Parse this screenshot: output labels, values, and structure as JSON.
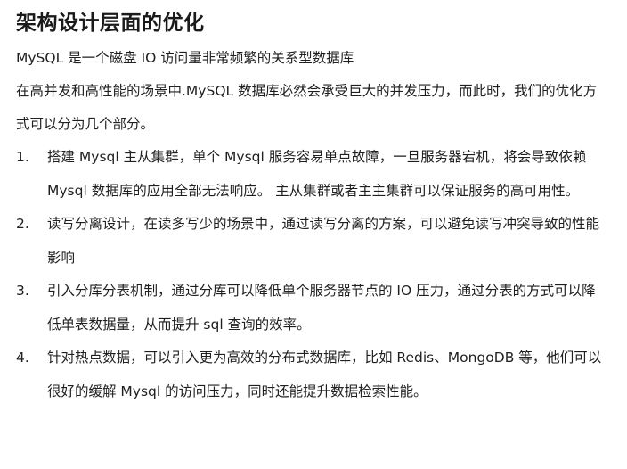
{
  "title": "架构设计层面的优化",
  "intro": [
    "MySQL 是一个磁盘 IO 访问量非常频繁的关系型数据库",
    "在高并发和高性能的场景中.MySQL 数据库必然会承受巨大的并发压力，而此时，我们的优化方式可以分为几个部分。"
  ],
  "items": [
    {
      "num": "1.",
      "text": "搭建 Mysql 主从集群，单个 Mysql 服务容易单点故障，一旦服务器宕机，将会导致依赖 Mysql 数据库的应用全部无法响应。 主从集群或者主主集群可以保证服务的高可用性。"
    },
    {
      "num": "2.",
      "text": "读写分离设计，在读多写少的场景中，通过读写分离的方案，可以避免读写冲突导致的性能影响"
    },
    {
      "num": "3.",
      "text": "引入分库分表机制，通过分库可以降低单个服务器节点的 IO 压力，通过分表的方式可以降低单表数据量，从而提升 sql 查询的效率。"
    },
    {
      "num": "4.",
      "text": "针对热点数据，可以引入更为高效的分布式数据库，比如 Redis、MongoDB 等，他们可以很好的缓解 Mysql 的访问压力，同时还能提升数据检索性能。"
    }
  ]
}
